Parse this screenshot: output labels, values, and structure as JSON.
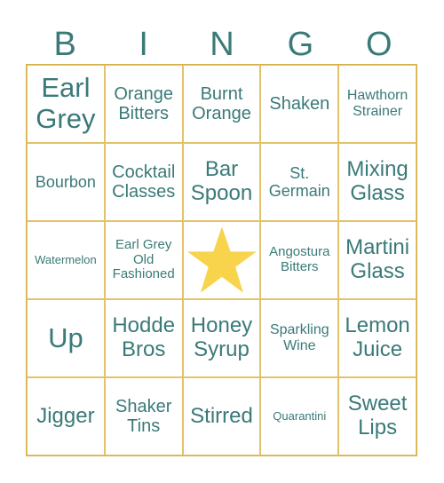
{
  "header": {
    "letters": [
      "B",
      "I",
      "N",
      "G",
      "O"
    ]
  },
  "colors": {
    "text": "#3a7a78",
    "grid": "#e3c36a",
    "star": "#f7d44c"
  },
  "cells": [
    {
      "text": "Earl Grey",
      "size": "s1"
    },
    {
      "text": "Orange Bitters",
      "size": "s3"
    },
    {
      "text": "Burnt Orange",
      "size": "s3"
    },
    {
      "text": "Shaken",
      "size": "s3"
    },
    {
      "text": "Hawthorn Strainer",
      "size": "s5"
    },
    {
      "text": "Bourbon",
      "size": "s4"
    },
    {
      "text": "Cocktail Classes",
      "size": "s3"
    },
    {
      "text": "Bar Spoon",
      "size": "s2"
    },
    {
      "text": "St. Germain",
      "size": "s4"
    },
    {
      "text": "Mixing Glass",
      "size": "s2"
    },
    {
      "text": "Watermelon",
      "size": "s7"
    },
    {
      "text": "Earl Grey Old Fashioned",
      "size": "s6"
    },
    {
      "text": "",
      "free": true,
      "icon": "star-icon"
    },
    {
      "text": "Angostura Bitters",
      "size": "s6"
    },
    {
      "text": "Martini Glass",
      "size": "s2"
    },
    {
      "text": "Up",
      "size": "s1"
    },
    {
      "text": "Hodde Bros",
      "size": "s2"
    },
    {
      "text": "Honey Syrup",
      "size": "s2"
    },
    {
      "text": "Sparkling Wine",
      "size": "s5"
    },
    {
      "text": "Lemon Juice",
      "size": "s2"
    },
    {
      "text": "Jigger",
      "size": "s2"
    },
    {
      "text": "Shaker Tins",
      "size": "s3"
    },
    {
      "text": "Stirred",
      "size": "s2"
    },
    {
      "text": "Quarantini",
      "size": "s7"
    },
    {
      "text": "Sweet Lips",
      "size": "s2"
    }
  ]
}
